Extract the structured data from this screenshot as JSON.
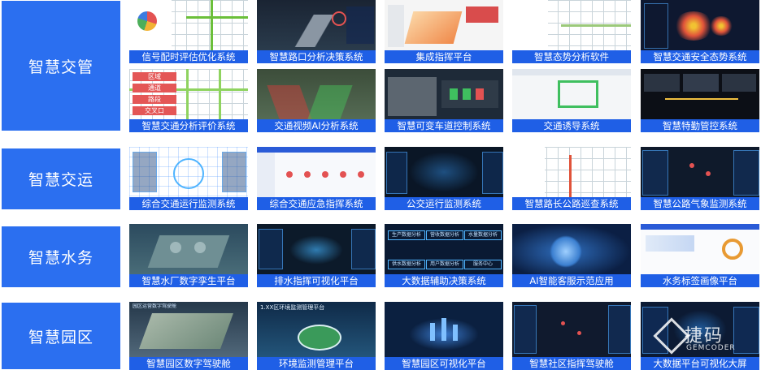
{
  "categories": [
    {
      "label": "智慧交管"
    },
    {
      "label": "智慧交运"
    },
    {
      "label": "智慧水务"
    },
    {
      "label": "智慧园区"
    }
  ],
  "tiles": [
    {
      "caption": "信号配时评估优化系统"
    },
    {
      "caption": "智慧路口分析决策系统"
    },
    {
      "caption": "集成指挥平台"
    },
    {
      "caption": "智慧态势分析软件"
    },
    {
      "caption": "智慧交通安全态势系统"
    },
    {
      "caption": "智慧交通分析评价系统"
    },
    {
      "caption": "交通视频AI分析系统"
    },
    {
      "caption": "智慧可变车道控制系统"
    },
    {
      "caption": "交通诱导系统"
    },
    {
      "caption": "智慧特勤管控系统"
    },
    {
      "caption": "综合交通运行监测系统"
    },
    {
      "caption": "综合交通应急指挥系统"
    },
    {
      "caption": "公交运行监测系统"
    },
    {
      "caption": "智慧路长公路巡查系统"
    },
    {
      "caption": "智慧公路气象监测系统"
    },
    {
      "caption": "智慧水厂数字孪生平台"
    },
    {
      "caption": "排水指挥可视化平台"
    },
    {
      "caption": "大数据辅助决策系统"
    },
    {
      "caption": "AI智能客服示范应用"
    },
    {
      "caption": "水务标签画像平台"
    },
    {
      "caption": "智慧园区数字驾驶舱"
    },
    {
      "caption": "环境监测管理平台"
    },
    {
      "caption": "智慧园区可视化平台"
    },
    {
      "caption": "智慧社区指挥驾驶舱"
    },
    {
      "caption": "大数据平台可视化大屏"
    }
  ],
  "tile_labels": {
    "analysis_tags": [
      "区域",
      "通道",
      "路段",
      "交叉口"
    ],
    "bigdata_cards": [
      "生产数据分析",
      "营收数据分析",
      "水量数据分析",
      "供水数据分析",
      "用户数据分析",
      "服务中心"
    ],
    "env_title": "1.XX区环境监测管理平台",
    "park_title": "园区运营数字驾驶舱"
  },
  "watermark": {
    "brand": "捷码",
    "sub": "GEMCODER"
  }
}
